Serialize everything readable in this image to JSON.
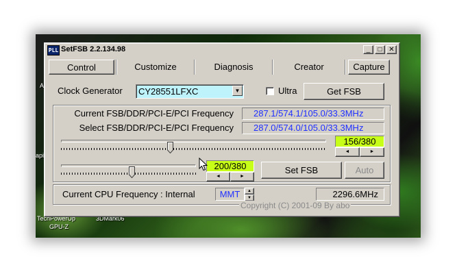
{
  "desktop": {
    "icon_labels": [
      "TechPowerUp",
      "3DMark06",
      "GPU-Z",
      "A",
      "api"
    ]
  },
  "window": {
    "app_icon_text": "PLL",
    "title": "SetFSB 2.2.134.98",
    "caption": {
      "minimize": "_",
      "maximize": "□",
      "close": "✕"
    }
  },
  "tabs": [
    {
      "label": "Control",
      "active": true
    },
    {
      "label": "Customize",
      "active": false
    },
    {
      "label": "Diagnosis",
      "active": false
    },
    {
      "label": "Creator",
      "active": false
    }
  ],
  "capture_label": "Capture",
  "clock": {
    "label": "Clock Generator",
    "selected": "CY28551LFXC",
    "ultra_label": "Ultra",
    "ultra_checked": false,
    "get_fsb_label": "Get FSB"
  },
  "frequency": {
    "current_label": "Current FSB/DDR/PCI-E/PCI Frequency",
    "current_value": "287.1/574.1/105.0/33.3MHz",
    "select_label": "Select FSB/DDR/PCI-E/PCI Frequency",
    "select_value": "287.0/574.0/105.0/33.3MHz"
  },
  "slider1": {
    "value_text": "156/380",
    "fraction": 0.4105
  },
  "slider2": {
    "value_text": "200/380",
    "fraction": 0.526
  },
  "set_fsb_label": "Set FSB",
  "auto_label": "Auto",
  "cpu": {
    "label": "Current CPU Frequency : Internal",
    "mode": "MMT",
    "value": "2296.6MHz"
  },
  "copyright": "Copyright (C) 2001-09 By abo",
  "colors": {
    "value_highlight": "#c8ff18",
    "combo_bg": "#bff3fb",
    "readout_text": "#2030ff",
    "window_face": "#d4d0c8"
  },
  "icons": {
    "spin_left": "◄",
    "spin_right": "►",
    "spin_up": "▲",
    "spin_down": "▼",
    "combo_arrow": "▼",
    "cursor": "mouse-pointer"
  }
}
